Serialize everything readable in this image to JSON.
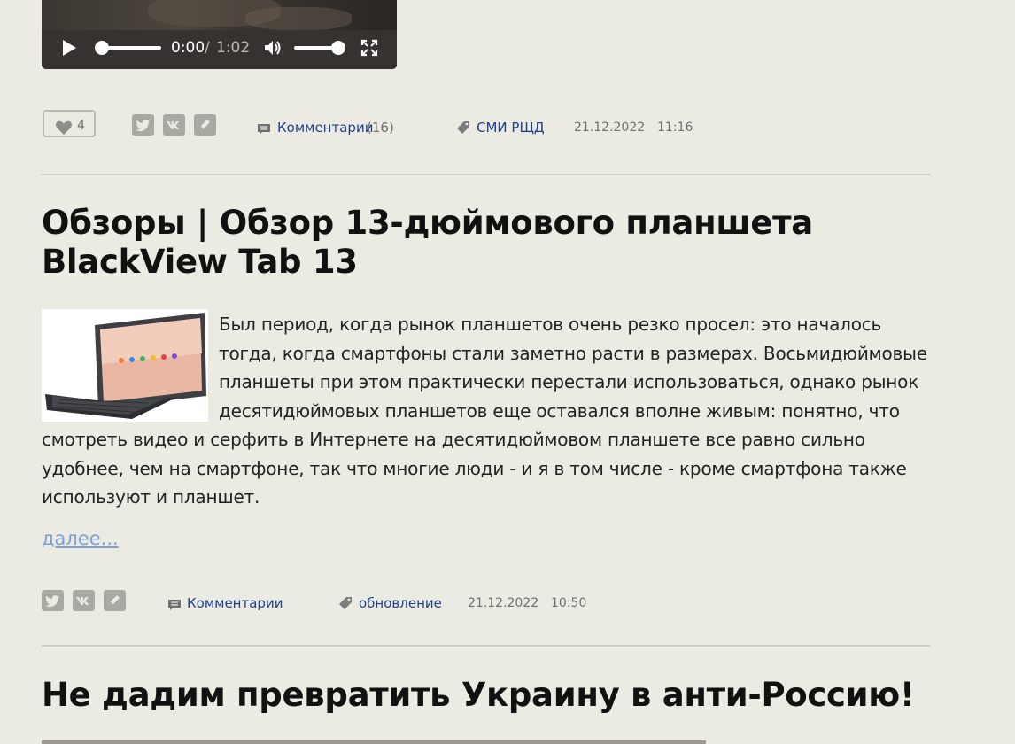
{
  "video": {
    "current_time": "0:00",
    "separator": "/",
    "duration": "1:02",
    "progress": 0,
    "volume": 1.0
  },
  "post1_meta": {
    "likes": "4",
    "comments_label": "Комментарии",
    "comments_count": "(16)",
    "tag": "СМИ РЩД",
    "date": "21.12.2022",
    "time": "11:16"
  },
  "post2": {
    "title": "Обзоры | Обзор 13-дюймового планшета BlackView Tab 13",
    "body": "Был период, когда рынок планшетов очень резко просел: это началось тогда, когда смартфоны стали заметно расти в размерах. Восьмидюймовые планшеты при этом практически перестали использоваться, однако рынок десятидюймовых планшетов еще оставался вполне живым: понятно, что смотреть видео и серфить в Интернете на десятидюймовом планшете все равно сильно удобнее, чем на смартфоне, так что многие люди - и я в том числе - кроме смартфона также используют и планшет.",
    "more_label": "далее...",
    "comments_label": "Комментарии",
    "tag": "обновление",
    "date": "21.12.2022",
    "time": "10:50"
  },
  "post3": {
    "title": "Не дадим превратить Украину в анти-Россию!"
  },
  "icons": {
    "share": [
      "twitter-icon",
      "vk-icon",
      "livejournal-icon"
    ],
    "comment": "comment-icon",
    "tag": "tag-icon",
    "like": "heart-icon"
  },
  "colors": {
    "background": "#ecebe3",
    "link": "#1f3f8c",
    "more_link": "#7ea0d5",
    "share_button": "#a9a8a2"
  }
}
